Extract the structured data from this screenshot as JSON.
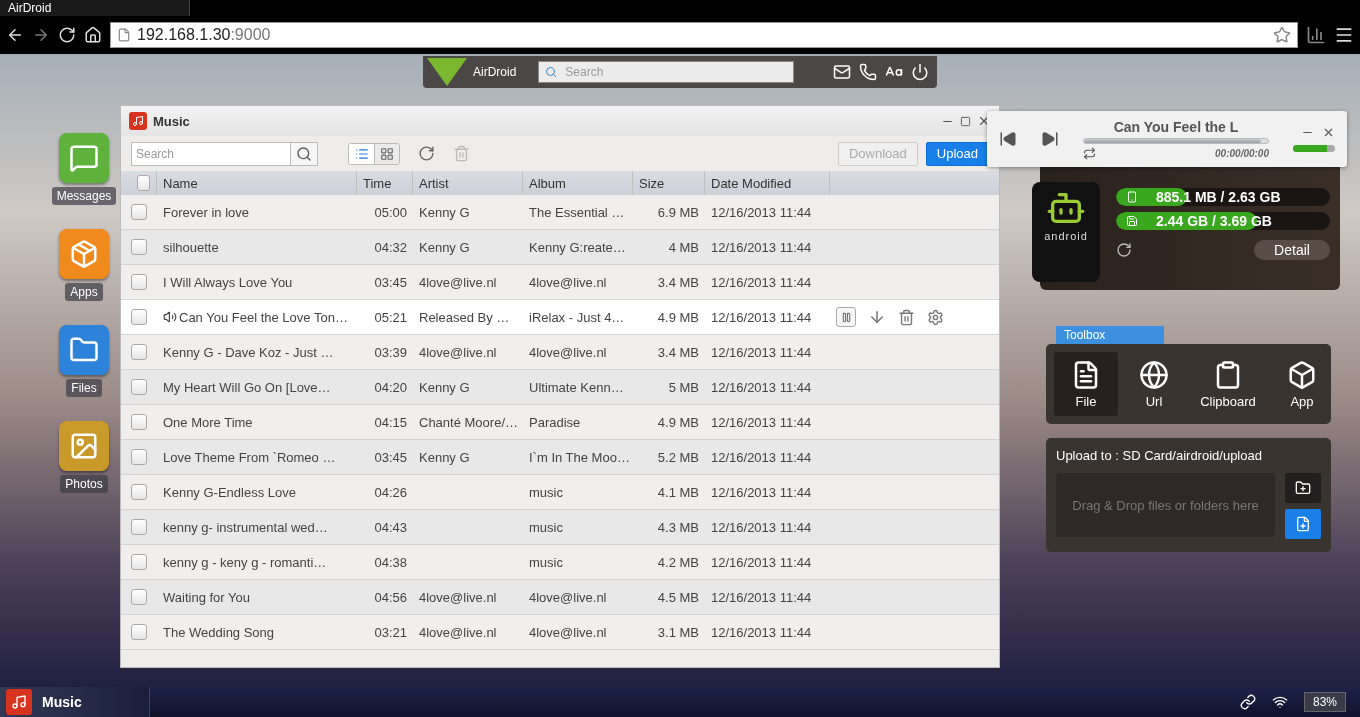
{
  "browser": {
    "tab_title": "AirDroid",
    "url_host": "192.168.1.30",
    "url_port": ":9000"
  },
  "topbar": {
    "logo": "AirDroid",
    "search_placeholder": "Search"
  },
  "desktop_icons": [
    {
      "kind": "messages",
      "label": "Messages"
    },
    {
      "kind": "apps",
      "label": "Apps"
    },
    {
      "kind": "files",
      "label": "Files"
    },
    {
      "kind": "photos",
      "label": "Photos"
    }
  ],
  "music_window": {
    "title": "Music",
    "search_placeholder": "Search",
    "view_modes": [
      {
        "kind": "list",
        "selected": true
      },
      {
        "kind": "grid",
        "selected": false
      }
    ],
    "buttons": [
      {
        "label": "Download",
        "disabled": true
      },
      {
        "label": "Upload",
        "disabled": false
      }
    ],
    "select_all_checked": false,
    "columns": [
      "Name",
      "Time",
      "Artist",
      "Album",
      "Size",
      "Date Modified"
    ],
    "rows": [
      {
        "name": "Forever in love",
        "time": "05:00",
        "artist": "Kenny G",
        "album": "The Essential …",
        "size": "6.9 MB",
        "date": "12/16/2013 11:44",
        "playing": false,
        "checked": false
      },
      {
        "name": "silhouette",
        "time": "04:32",
        "artist": "Kenny G",
        "album": "Kenny G:reate…",
        "size": "4 MB",
        "date": "12/16/2013 11:44",
        "playing": false,
        "checked": false
      },
      {
        "name": "I Will Always Love You",
        "time": "03:45",
        "artist": "4love@live.nl",
        "album": "4love@live.nl",
        "size": "3.4 MB",
        "date": "12/16/2013 11:44",
        "playing": false,
        "checked": false
      },
      {
        "name": "Can You Feel the Love Ton…",
        "time": "05:21",
        "artist": "Released By …",
        "album": "iRelax - Just 4…",
        "size": "4.9 MB",
        "date": "12/16/2013 11:44",
        "playing": true,
        "checked": false
      },
      {
        "name": "Kenny G - Dave Koz - Just …",
        "time": "03:39",
        "artist": "4love@live.nl",
        "album": "4love@live.nl",
        "size": "3.4 MB",
        "date": "12/16/2013 11:44",
        "playing": false,
        "checked": false
      },
      {
        "name": "My Heart Will Go On [Love…",
        "time": "04:20",
        "artist": "Kenny G",
        "album": "Ultimate Kenn…",
        "size": "5 MB",
        "date": "12/16/2013 11:44",
        "playing": false,
        "checked": false
      },
      {
        "name": "One More Time",
        "time": "04:15",
        "artist": "Chanté Moore/…",
        "album": "Paradise",
        "size": "4.9 MB",
        "date": "12/16/2013 11:44",
        "playing": false,
        "checked": false
      },
      {
        "name": "Love Theme From `Romeo …",
        "time": "03:45",
        "artist": "Kenny G",
        "album": "I`m In The Moo…",
        "size": "5.2 MB",
        "date": "12/16/2013 11:44",
        "playing": false,
        "checked": false
      },
      {
        "name": "Kenny G-Endless Love",
        "time": "04:26",
        "artist": "",
        "album": "music",
        "size": "4.1 MB",
        "date": "12/16/2013 11:44",
        "playing": false,
        "checked": false
      },
      {
        "name": "kenny g- instrumental wed…",
        "time": "04:43",
        "artist": "",
        "album": "music",
        "size": "4.3 MB",
        "date": "12/16/2013 11:44",
        "playing": false,
        "checked": false
      },
      {
        "name": "kenny g - keny g - romanti…",
        "time": "04:38",
        "artist": "",
        "album": "music",
        "size": "4.2 MB",
        "date": "12/16/2013 11:44",
        "playing": false,
        "checked": false
      },
      {
        "name": "Waiting for You",
        "time": "04:56",
        "artist": "4love@live.nl",
        "album": "4love@live.nl",
        "size": "4.5 MB",
        "date": "12/16/2013 11:44",
        "playing": false,
        "checked": false
      },
      {
        "name": "The Wedding Song",
        "time": "03:21",
        "artist": "4love@live.nl",
        "album": "4love@live.nl",
        "size": "3.1 MB",
        "date": "12/16/2013 11:44",
        "playing": false,
        "checked": false
      }
    ]
  },
  "player": {
    "title": "Can You Feel the L",
    "time": "00:00/00:00",
    "progress": {
      "level": 0.96
    },
    "volume": {
      "level": 0.8
    }
  },
  "device": {
    "phone_label": "android",
    "storage": [
      {
        "kind": "phone",
        "text": "885.1 MB / 2.63 GB",
        "level": 0.33
      },
      {
        "kind": "sd",
        "text": "2.44 GB / 3.69 GB",
        "level": 0.66
      }
    ],
    "detail": "Detail"
  },
  "toolbox": {
    "title": "Toolbox",
    "tools": [
      {
        "kind": "file",
        "label": "File",
        "selected": true
      },
      {
        "kind": "url",
        "label": "Url",
        "selected": false
      },
      {
        "kind": "clipboard",
        "label": "Clipboard",
        "selected": false
      },
      {
        "kind": "app",
        "label": "App",
        "selected": false
      }
    ],
    "upload_to": "Upload to : SD Card/airdroid/upload",
    "drop_placeholder": "Drag & Drop files or folders here"
  },
  "taskbar": {
    "app": "Music",
    "battery": "83%"
  }
}
